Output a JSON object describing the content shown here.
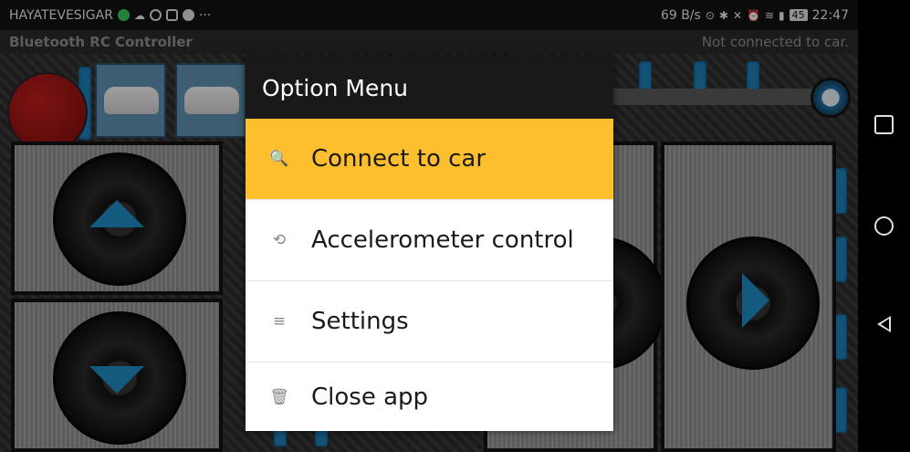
{
  "status_bar": {
    "carrier": "HAYATEVESIGAR",
    "more": "···",
    "speed": "69 B/s",
    "battery": "45",
    "time": "22:47"
  },
  "app_bar": {
    "title": "Bluetooth RC Controller",
    "connection_status": "Not connected to car."
  },
  "dialog": {
    "title": "Option Menu",
    "items": [
      {
        "label": "Connect to car",
        "icon": "search-icon",
        "glyph": "🔍",
        "active": true
      },
      {
        "label": "Accelerometer control",
        "icon": "rotate-device-icon",
        "glyph": "⟲",
        "active": false
      },
      {
        "label": "Settings",
        "icon": "sort-icon",
        "glyph": "≡",
        "active": false
      },
      {
        "label": "Close app",
        "icon": "trash-icon",
        "glyph": "🗑",
        "active": false
      }
    ]
  },
  "colors": {
    "accent": "#fdbf2d",
    "control_blue": "#1f8ac4",
    "title_bg": "#191919"
  }
}
